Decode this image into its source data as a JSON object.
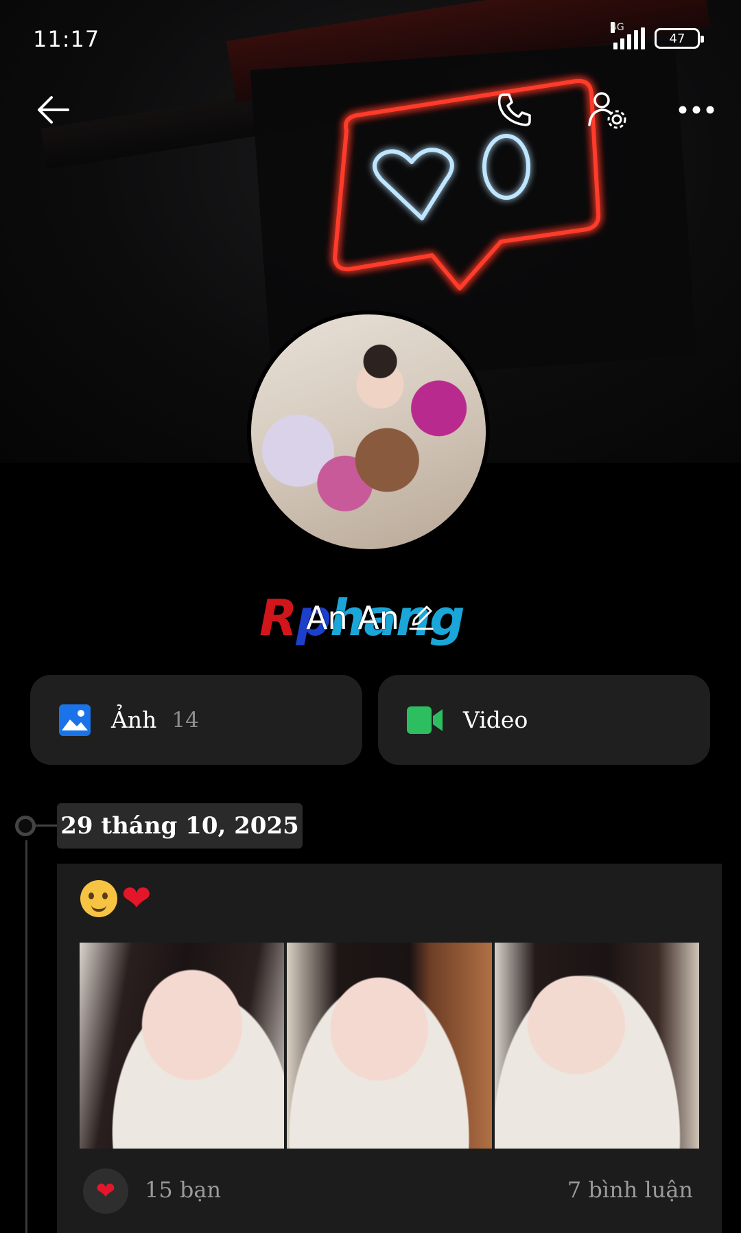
{
  "status_bar": {
    "time": "11:17",
    "network": "4G",
    "battery": "47"
  },
  "top_bar": {
    "back_icon": "arrow-left-icon",
    "call_icon": "phone-icon",
    "settings_icon": "user-settings-icon",
    "more_icon": "more-horizontal-icon"
  },
  "profile": {
    "badge_text": {
      "r": "R",
      "p": "p",
      "h": "hang"
    },
    "display_name": "An An",
    "edit_icon": "pencil-icon"
  },
  "media": {
    "photos_label": "Ảnh",
    "photos_count": "14",
    "video_label": "Video",
    "photos_icon_color": "#1a73e8",
    "video_icon_color": "#2dbe60"
  },
  "timeline": {
    "date": "29 tháng 10, 2025"
  },
  "post": {
    "emoji_heart": "❤",
    "like_heart": "❤",
    "likes": "15 bạn",
    "comments": "7 bình luận"
  }
}
